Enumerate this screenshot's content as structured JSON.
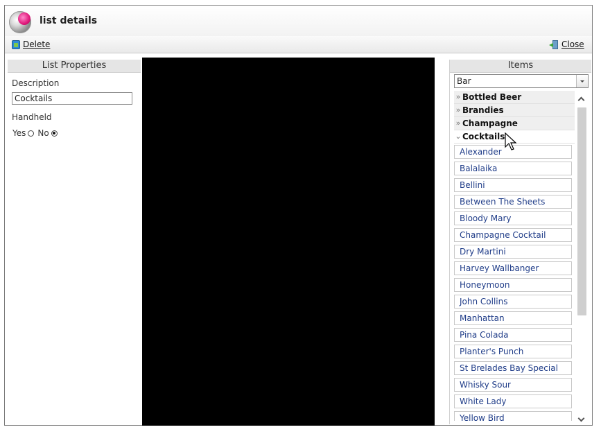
{
  "window": {
    "title": "list details"
  },
  "toolbar": {
    "delete_label": "Delete",
    "close_label": "Close"
  },
  "left": {
    "heading": "List Properties",
    "description_label": "Description",
    "description_value": "Cocktails",
    "handheld_label": "Handheld",
    "yes_label": "Yes",
    "no_label": "No",
    "handheld_selected": "No"
  },
  "right": {
    "heading": "Items",
    "select_value": "Bar",
    "groups": [
      {
        "label": "Bottled Beer",
        "expanded": false
      },
      {
        "label": "Brandies",
        "expanded": false
      },
      {
        "label": "Champagne",
        "expanded": false
      },
      {
        "label": "Cocktails",
        "expanded": true
      }
    ],
    "items": [
      "Alexander",
      "Balalaika",
      "Bellini",
      "Between The Sheets",
      "Bloody Mary",
      "Champagne Cocktail",
      "Dry Martini",
      "Harvey Wallbanger",
      "Honeymoon",
      "John Collins",
      "Manhattan",
      "Pina Colada",
      "Planter's Punch",
      "St Brelades Bay Special",
      "Whisky Sour",
      "White Lady",
      "Yellow Bird"
    ]
  },
  "icons": {
    "delete": "recycle-bin-icon",
    "close": "exit-door-icon",
    "collapsed": "double-chevron-right-icon",
    "expanded": "double-chevron-down-icon"
  }
}
